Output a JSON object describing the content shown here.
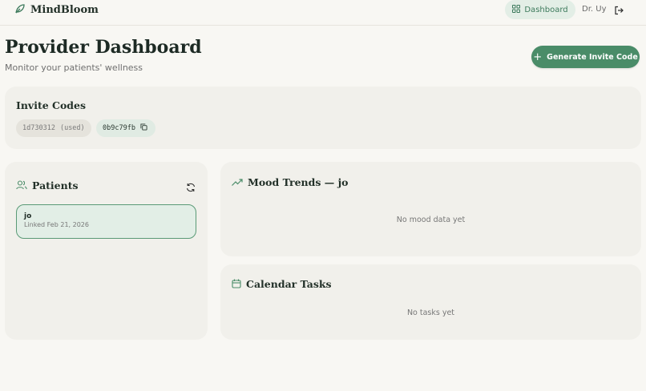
{
  "header": {
    "brand": "MindBloom",
    "nav_dashboard": "Dashboard",
    "user": "Dr. Uy",
    "icons": {
      "brand": "leaf-icon",
      "dashboard": "grid-icon",
      "logout": "logout-icon"
    }
  },
  "page": {
    "title": "Provider Dashboard",
    "subtitle": "Monitor your patients' wellness",
    "generate_button": "Generate Invite Code"
  },
  "invite_codes": {
    "title": "Invite Codes",
    "codes": [
      {
        "code": "1d730312",
        "status": "(used)"
      },
      {
        "code": "0b9c79fb",
        "status": ""
      }
    ]
  },
  "patients": {
    "title": "Patients",
    "items": [
      {
        "name": "jo",
        "linked": "Linked Feb 21, 2026"
      }
    ]
  },
  "mood": {
    "title": "Mood Trends — jo",
    "empty": "No mood data yet"
  },
  "tasks": {
    "title": "Calendar Tasks",
    "empty": "No tasks yet"
  },
  "colors": {
    "accent": "#4a8c68",
    "accent_light": "#e2eee6",
    "background": "#f8f7f3",
    "card": "#f1f0eb"
  }
}
